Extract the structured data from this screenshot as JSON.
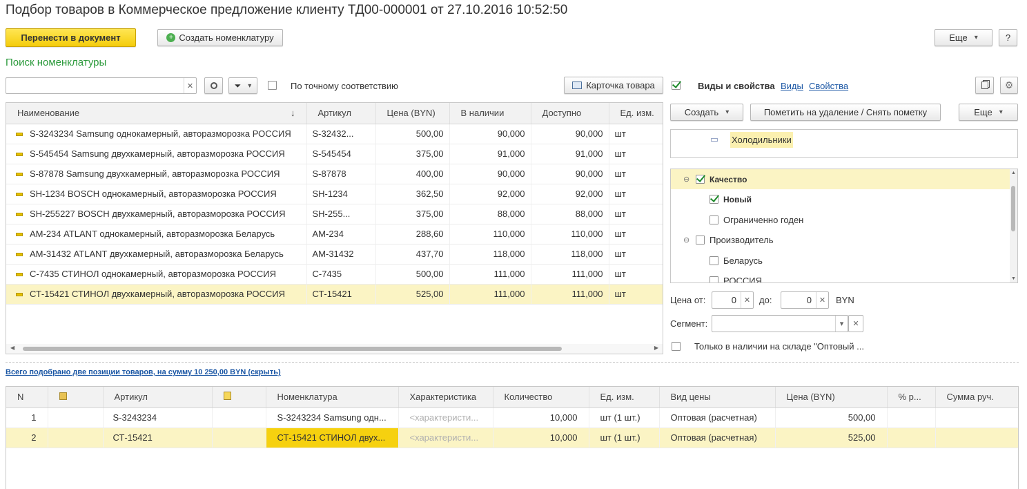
{
  "title": "Подбор товаров в Коммерческое предложение клиенту ТД00-000001 от 27.10.2016 10:52:50",
  "toolbar": {
    "transfer": "Перенести в документ",
    "create_item": "Создать номенклатуру",
    "more": "Еще",
    "help": "?"
  },
  "search": {
    "section_title": "Поиск номенклатуры",
    "value": "",
    "exact_match": "По точному соответствию",
    "card_button": "Карточка товара"
  },
  "grid": {
    "headers": [
      "Наименование",
      "Артикул",
      "Цена (BYN)",
      "В наличии",
      "Доступно",
      "Ед. изм."
    ],
    "sort_indicator": "↓",
    "rows": [
      {
        "name": "S-3243234 Samsung однокамерный, авторазморозка РОССИЯ",
        "article": "S-32432...",
        "price": "500,00",
        "stock": "90,000",
        "avail": "90,000",
        "unit": "шт"
      },
      {
        "name": "S-545454 Samsung двухкамерный, авторазморозка РОССИЯ",
        "article": "S-545454",
        "price": "375,00",
        "stock": "91,000",
        "avail": "91,000",
        "unit": "шт"
      },
      {
        "name": "S-87878 Samsung двухкамерный, авторазморозка РОССИЯ",
        "article": "S-87878",
        "price": "400,00",
        "stock": "90,000",
        "avail": "90,000",
        "unit": "шт"
      },
      {
        "name": "SH-1234 BOSCH однокамерный, авторазморозка РОССИЯ",
        "article": "SH-1234",
        "price": "362,50",
        "stock": "92,000",
        "avail": "92,000",
        "unit": "шт"
      },
      {
        "name": "SH-255227 BOSCH двухкамерный, авторазморозка РОССИЯ",
        "article": "SH-255...",
        "price": "375,00",
        "stock": "88,000",
        "avail": "88,000",
        "unit": "шт"
      },
      {
        "name": "АМ-234 ATLANT однокамерный, авторазморозка Беларусь",
        "article": "АМ-234",
        "price": "288,60",
        "stock": "110,000",
        "avail": "110,000",
        "unit": "шт"
      },
      {
        "name": "АМ-31432 ATLANT двухкамерный, авторазморозка Беларусь",
        "article": "АМ-31432",
        "price": "437,70",
        "stock": "118,000",
        "avail": "118,000",
        "unit": "шт"
      },
      {
        "name": "С-7435 СТИНОЛ однокамерный, авторазморозка РОССИЯ",
        "article": "С-7435",
        "price": "500,00",
        "stock": "111,000",
        "avail": "111,000",
        "unit": "шт"
      },
      {
        "name": "СТ-15421 СТИНОЛ двухкамерный, авторазморозка РОССИЯ",
        "article": "СТ-15421",
        "price": "525,00",
        "stock": "111,000",
        "avail": "111,000",
        "unit": "шт"
      }
    ]
  },
  "right": {
    "header": "Виды и свойства",
    "link_kinds": "Виды",
    "link_props": "Свойства",
    "create": "Создать",
    "mark_delete": "Пометить на удаление / Снять пометку",
    "more": "Еще",
    "category": "Холодильники",
    "props": [
      {
        "label": "Качество",
        "checked": true,
        "level": 0
      },
      {
        "label": "Новый",
        "checked": true,
        "level": 1
      },
      {
        "label": "Ограниченно годен",
        "checked": false,
        "level": 1
      },
      {
        "label": "Производитель",
        "checked": false,
        "level": 0
      },
      {
        "label": "Беларусь",
        "checked": false,
        "level": 1
      },
      {
        "label": "РОССИЯ",
        "checked": false,
        "level": 1
      }
    ],
    "price_from_label": "Цена от:",
    "price_from": "0",
    "price_to_label": "до:",
    "price_to": "0",
    "currency": "BYN",
    "segment_label": "Сегмент:",
    "segment_value": "",
    "only_in_stock": "Только в наличии на складе \"Оптовый ..."
  },
  "summary_link": "Всего подобрано две позиции товаров, на сумму 10 250,00 BYN (скрыть)",
  "bottom": {
    "headers": [
      "N",
      "",
      "Артикул",
      "",
      "Номенклатура",
      "Характеристика",
      "Количество",
      "Ед. изм.",
      "Вид цены",
      "Цена (BYN)",
      "% р...",
      "Сумма руч."
    ],
    "rows": [
      {
        "n": "1",
        "article": "S-3243234",
        "name": "S-3243234 Samsung одн...",
        "char": "<характеристи...",
        "qty": "10,000",
        "unit": "шт (1 шт.)",
        "price_type": "Оптовая (расчетная)",
        "price": "500,00"
      },
      {
        "n": "2",
        "article": "СТ-15421",
        "name": "СТ-15421 СТИНОЛ двух...",
        "char": "<характеристи...",
        "qty": "10,000",
        "unit": "шт (1 шт.)",
        "price_type": "Оптовая (расчетная)",
        "price": "525,00"
      }
    ]
  }
}
